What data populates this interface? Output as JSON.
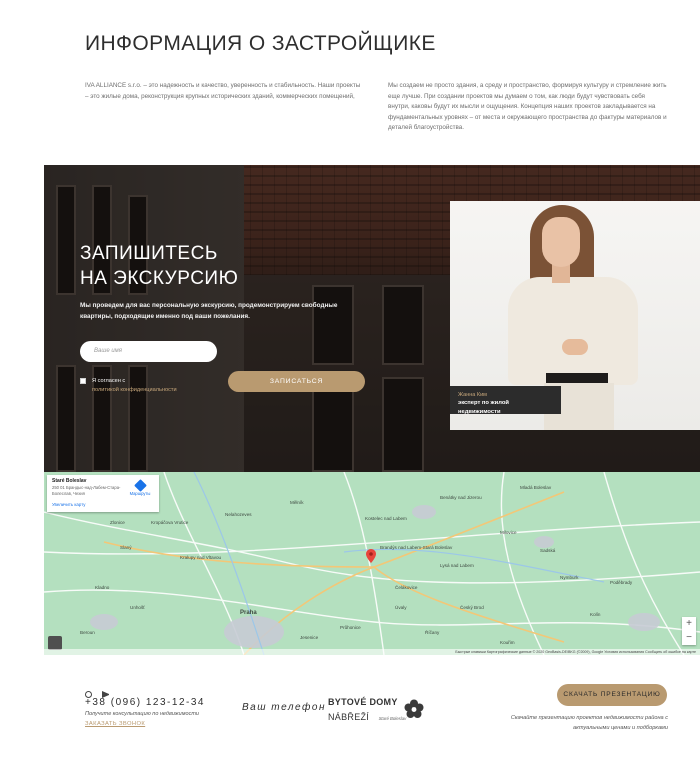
{
  "developer": {
    "title": "ИНФОРМАЦИЯ О ЗАСТРОЙЩИКЕ",
    "text_left": "IVA ALLIANCE s.r.o. – это надежность и качество, уверенность и стабильность. Наши проекты – это жилые дома, реконструкция крупных исторических зданий, коммерческих помещений,",
    "text_right": "Мы создаем не просто здания, а среду и пространство, формируя культуру и стремление жить еще лучше. При создании проектов мы думаем о том, как люди будут чувствовать себя внутри, каковы будут их мысли и ощущения. Концепция наших проектов закладывается на фундаментальных уровнях – от места и окружающего пространства до фактуры материалов и деталей благоустройства."
  },
  "excursion": {
    "title_line1": "ЗАПИШИТЕСЬ",
    "title_line2": "НА ЭКСКУРСИЮ",
    "description": "Мы проведем для вас персональную экскурсию, продемонстрируем свободные квартиры, подходящие именно под ваши пожелания.",
    "name_placeholder": "Ваше имя",
    "phone_placeholder": "Ваш телефон",
    "consent_text": "Я согласен с",
    "consent_link": "политикой конфиденциальности",
    "submit_label": "ЗАПИСАТЬСЯ",
    "expert_name": "Жанна Ким",
    "expert_role": "эксперт по жилой недвижимости"
  },
  "map": {
    "card_place": "Staré Boleslav",
    "card_address": "250 01 Брандыс-над-Лабем-Стара-Болеслав, Чехия",
    "card_route": "Маршруты",
    "card_enlarge": "Увеличить карту",
    "labels": [
      "Kropáčova Vrutice",
      "Benátky nad Jizerou",
      "Mladá Boleslav",
      "Nelahozeves",
      "Mělník",
      "Kostelec nad Labem",
      "Brandýs nad Labem-Stará Boleslav",
      "Lysá nad Labem",
      "Nymburk",
      "Poděbrady",
      "Čelákovice",
      "Kralupy nad Vltavou",
      "Praha",
      "Úvaly",
      "Říčany",
      "Kolín",
      "Kladno",
      "Unhošť",
      "Beroun",
      "Jesenice",
      "Průhonice",
      "Kouřim",
      "Sadská",
      "Milovice",
      "Český Brod",
      "Zlonice",
      "Slaný",
      "Roudnice"
    ],
    "footer": "Быстрые клавиши   Картографические данные © 2020 GeoBasis-DE/BKG (©2009), Google   Условия использования   Сообщить об ошибке на карте"
  },
  "footer": {
    "phone": "+38 (096) 123-12-34",
    "phone_note": "Получите консультацию по недвижимости",
    "callback": "ЗАКАЗАТЬ ЗВОНОК",
    "logo_line1": "BYTOVÉ DOMY",
    "logo_line2": "NÁBŘEŽÍ",
    "logo_line3": "Staré Boleslav",
    "present_label": "СКАЧАТЬ ПРЕЗЕНТАЦИЮ",
    "present_note": "Скачайте презентацию проектов недвижимости района с актуальными ценами и подборками"
  }
}
